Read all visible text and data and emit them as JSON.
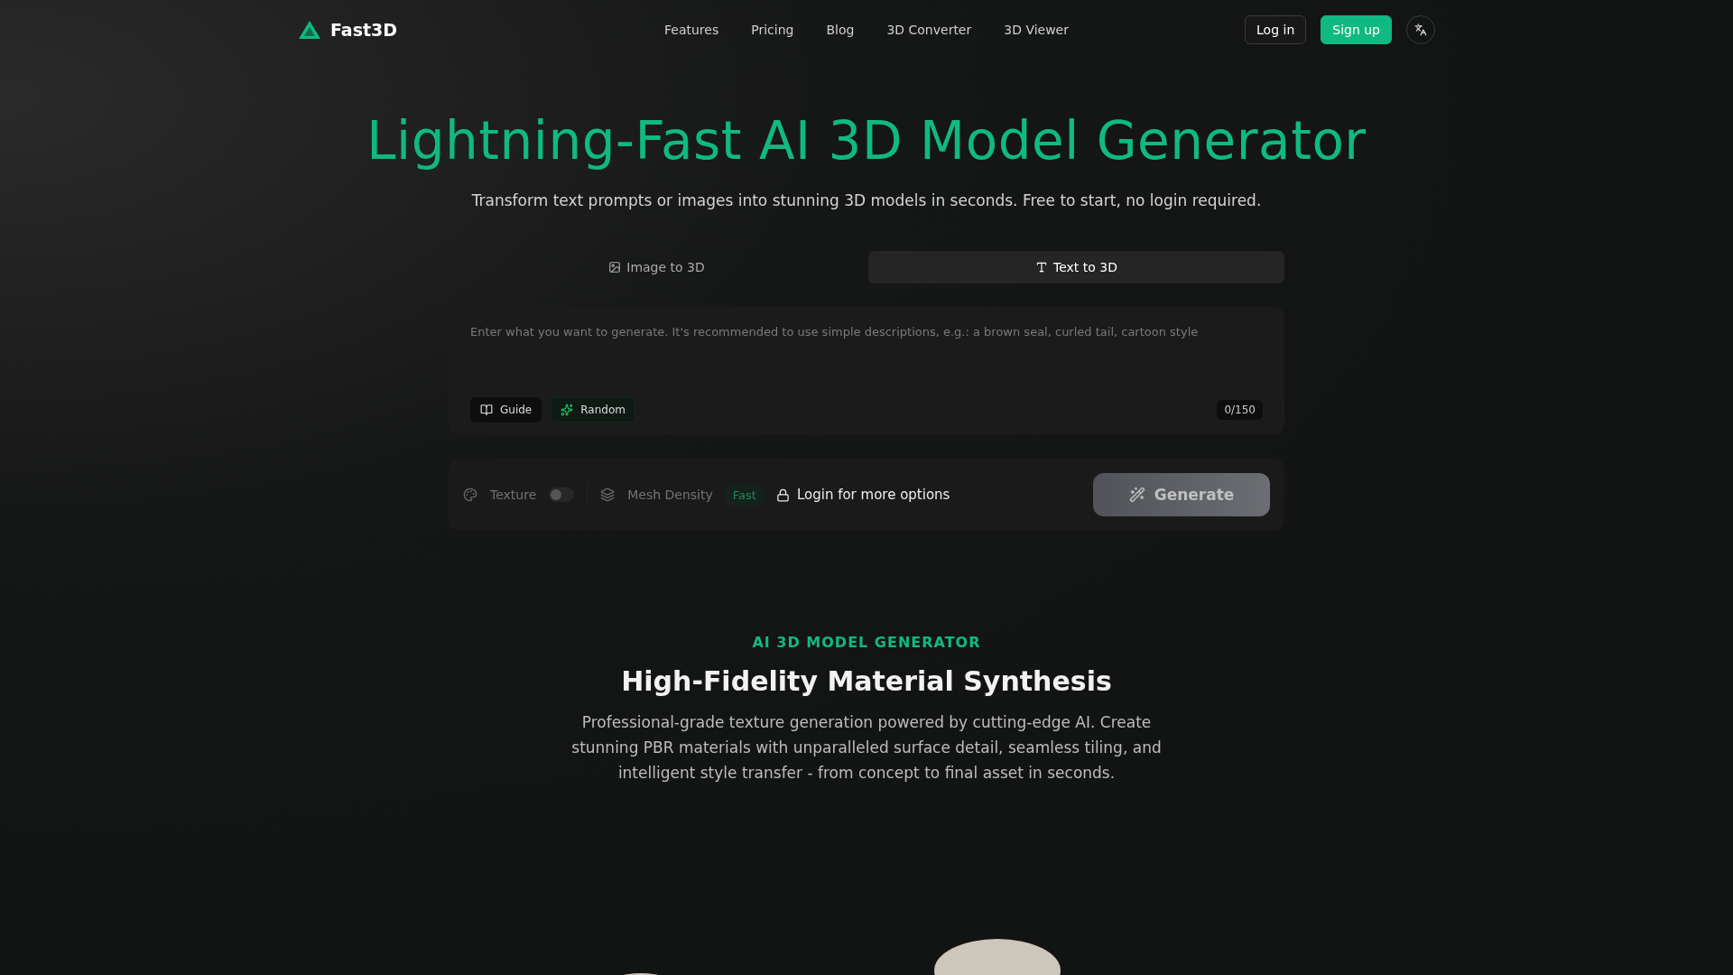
{
  "nav": {
    "brand": "Fast3D",
    "links": [
      "Features",
      "Pricing",
      "Blog",
      "3D Converter",
      "3D Viewer"
    ],
    "login": "Log in",
    "signup": "Sign up"
  },
  "hero": {
    "title": "Lightning-Fast AI 3D Model Generator",
    "subtitle": "Transform text prompts or images into stunning 3D models in seconds. Free to start, no login required."
  },
  "tabs": [
    {
      "label": "Image to 3D",
      "kind": "image",
      "selected": false
    },
    {
      "label": "Text to 3D",
      "kind": "text",
      "selected": true
    }
  ],
  "prompt": {
    "placeholder": "Enter what you want to generate. It's recommended to use simple descriptions, e.g.: a brown seal, curled tail, cartoon style",
    "guide": "Guide",
    "random": "Random",
    "count": "0/150"
  },
  "options": {
    "disabled": true,
    "texture": "Texture",
    "texture_on": false,
    "mesh_density": "Mesh Density",
    "mesh_value": "Fast",
    "login_hint": "Login for more options",
    "generate": "Generate"
  },
  "section": {
    "eyebrow": "AI 3D MODEL GENERATOR",
    "heading": "High-Fidelity Material Synthesis",
    "text": "Professional-grade texture generation powered by cutting-edge AI. Create stunning PBR materials with unparalleled surface detail, seamless tiling, and intelligent style transfer - from concept to final asset in seconds."
  }
}
